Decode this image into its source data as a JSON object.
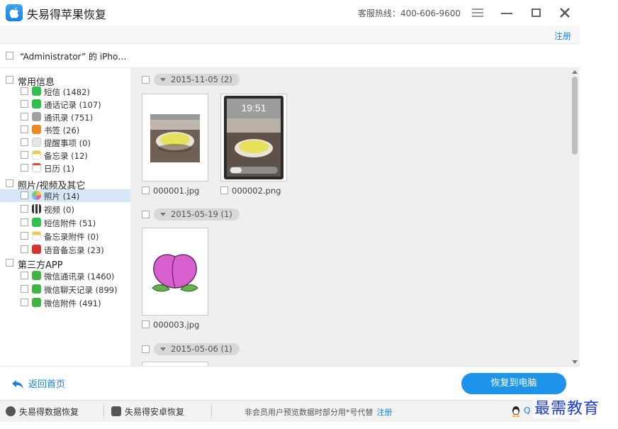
{
  "app": {
    "title": "失易得苹果恢复",
    "hotline": "客服热线：400-606-9600",
    "register": "注册"
  },
  "device": {
    "name": "“Administrator” 的 iPho…"
  },
  "sidebar": {
    "groups": [
      {
        "label": "常用信息",
        "items": [
          {
            "label": "短信 (1482)",
            "icon": "message-icon",
            "color": "#2fc24a"
          },
          {
            "label": "通话记录 (107)",
            "icon": "phone-icon",
            "color": "#2fc24a"
          },
          {
            "label": "通讯录 (751)",
            "icon": "contacts-icon",
            "color": "#a0a0a0"
          },
          {
            "label": "书签 (26)",
            "icon": "bookmark-icon",
            "color": "#f08a1c"
          },
          {
            "label": "提醒事项 (0)",
            "icon": "reminder-icon",
            "color": "#e6e6e6"
          },
          {
            "label": "备忘录 (12)",
            "icon": "notes-icon",
            "color": "#f2c94c"
          },
          {
            "label": "日历 (1)",
            "icon": "calendar-icon",
            "color": "#e6e6e6"
          }
        ]
      },
      {
        "label": "照片/视频及其它",
        "items": [
          {
            "label": "照片 (14)",
            "icon": "photos-icon",
            "color": "#e85d9b",
            "selected": true
          },
          {
            "label": "视频 (0)",
            "icon": "video-icon",
            "color": "#555555"
          },
          {
            "label": "短信附件 (51)",
            "icon": "attachment-icon",
            "color": "#2fc24a"
          },
          {
            "label": "备忘录附件 (0)",
            "icon": "notes-attachment-icon",
            "color": "#f2c94c"
          },
          {
            "label": "语音备忘录 (23)",
            "icon": "voice-memo-icon",
            "color": "#d9342b"
          }
        ]
      },
      {
        "label": "第三方APP",
        "items": [
          {
            "label": "微信通讯录 (1460)",
            "icon": "wechat-icon",
            "color": "#3cb83f"
          },
          {
            "label": "微信聊天记录 (899)",
            "icon": "wechat-icon",
            "color": "#3cb83f"
          },
          {
            "label": "微信附件 (491)",
            "icon": "wechat-icon",
            "color": "#3cb83f"
          }
        ]
      }
    ]
  },
  "content": {
    "date_groups": [
      {
        "date": "2015-11-05 (2)",
        "files": [
          {
            "name": "000001.jpg",
            "kind": "photo"
          },
          {
            "name": "000002.png",
            "kind": "lockscreen",
            "time": "19:51"
          }
        ]
      },
      {
        "date": "2015-05-19 (1)",
        "files": [
          {
            "name": "000003.jpg",
            "kind": "peach"
          }
        ]
      },
      {
        "date": "2015-05-06 (1)",
        "files": []
      }
    ]
  },
  "bottom": {
    "back_label": "返回首页",
    "recover_label": "恢复到电脑"
  },
  "status": {
    "data_recovery": "失易得数据恢复",
    "android_recovery": "失易得安卓恢复",
    "notice": "非会员用户预览数据时部分用*号代替",
    "register": "注册",
    "qq": "Q"
  },
  "watermark": "最需教育",
  "colors": {
    "accent": "#1a82de",
    "button": "#1e93ea",
    "selected_row": "#d6e7f7"
  }
}
